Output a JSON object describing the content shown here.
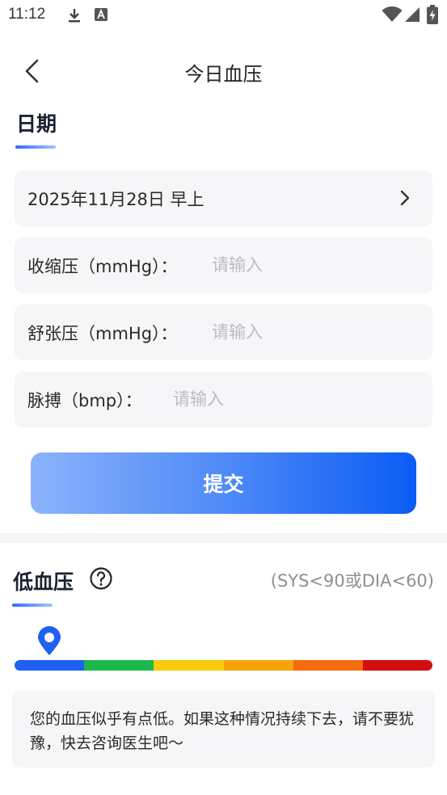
{
  "status_bar": {
    "time": "11:12",
    "icons": [
      "download-icon",
      "font-icon",
      "wifi-icon",
      "cellular-icon",
      "battery-charging-icon"
    ]
  },
  "header": {
    "title": "今日血压",
    "back_icon": "chevron-left-icon"
  },
  "date_section": {
    "title": "日期"
  },
  "form": {
    "date_value": "2025年11月28日 早上",
    "systolic_label": "收缩压（mmHg）：",
    "systolic_placeholder": "请输入",
    "diastolic_label": "舒张压（mmHg）：",
    "diastolic_placeholder": "请输入",
    "pulse_label": "脉搏（bmp）：",
    "pulse_placeholder": "请输入",
    "submit_label": "提交"
  },
  "result": {
    "title": "低血压",
    "help_icon": "question-circle-icon",
    "range_text": "(SYS<90或DIA<60)",
    "scale_colors": [
      "#1f5ff2",
      "#1cb84a",
      "#f8cc0a",
      "#f8a20c",
      "#f46b0c",
      "#d30e0e"
    ],
    "pin_icon": "location-pin-icon",
    "advice": "您的血压似乎有点低。如果这种情况持续下去，请不要犹豫，快去咨询医生吧～"
  }
}
